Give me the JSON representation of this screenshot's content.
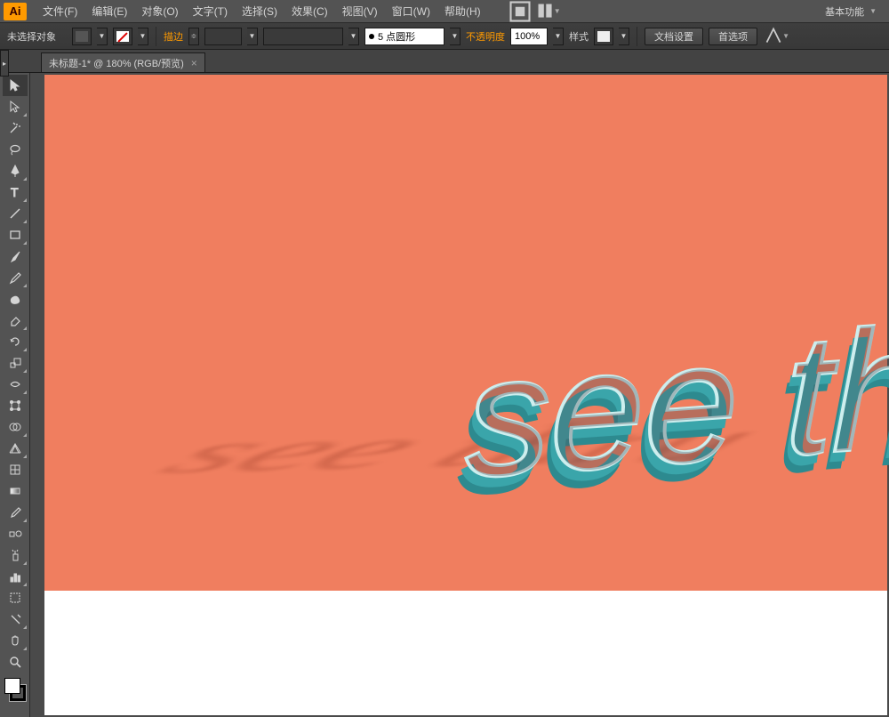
{
  "app": {
    "logo": "Ai"
  },
  "menu": {
    "file": "文件(F)",
    "edit": "编辑(E)",
    "object": "对象(O)",
    "type": "文字(T)",
    "select": "选择(S)",
    "effect": "效果(C)",
    "view": "视图(V)",
    "window": "窗口(W)",
    "help": "帮助(H)"
  },
  "workspace": "基本功能",
  "control": {
    "no_selection": "未选择对象",
    "stroke_label": "描边",
    "stroke_weight": "",
    "brush": "5 点圆形",
    "opacity_label": "不透明度",
    "opacity": "100%",
    "style_label": "样式",
    "doc_setup": "文档设置",
    "prefs": "首选项"
  },
  "tab": {
    "title": "未标题-1* @ 180% (RGB/预览)",
    "close": "×"
  },
  "artwork": {
    "text": "see thru"
  }
}
